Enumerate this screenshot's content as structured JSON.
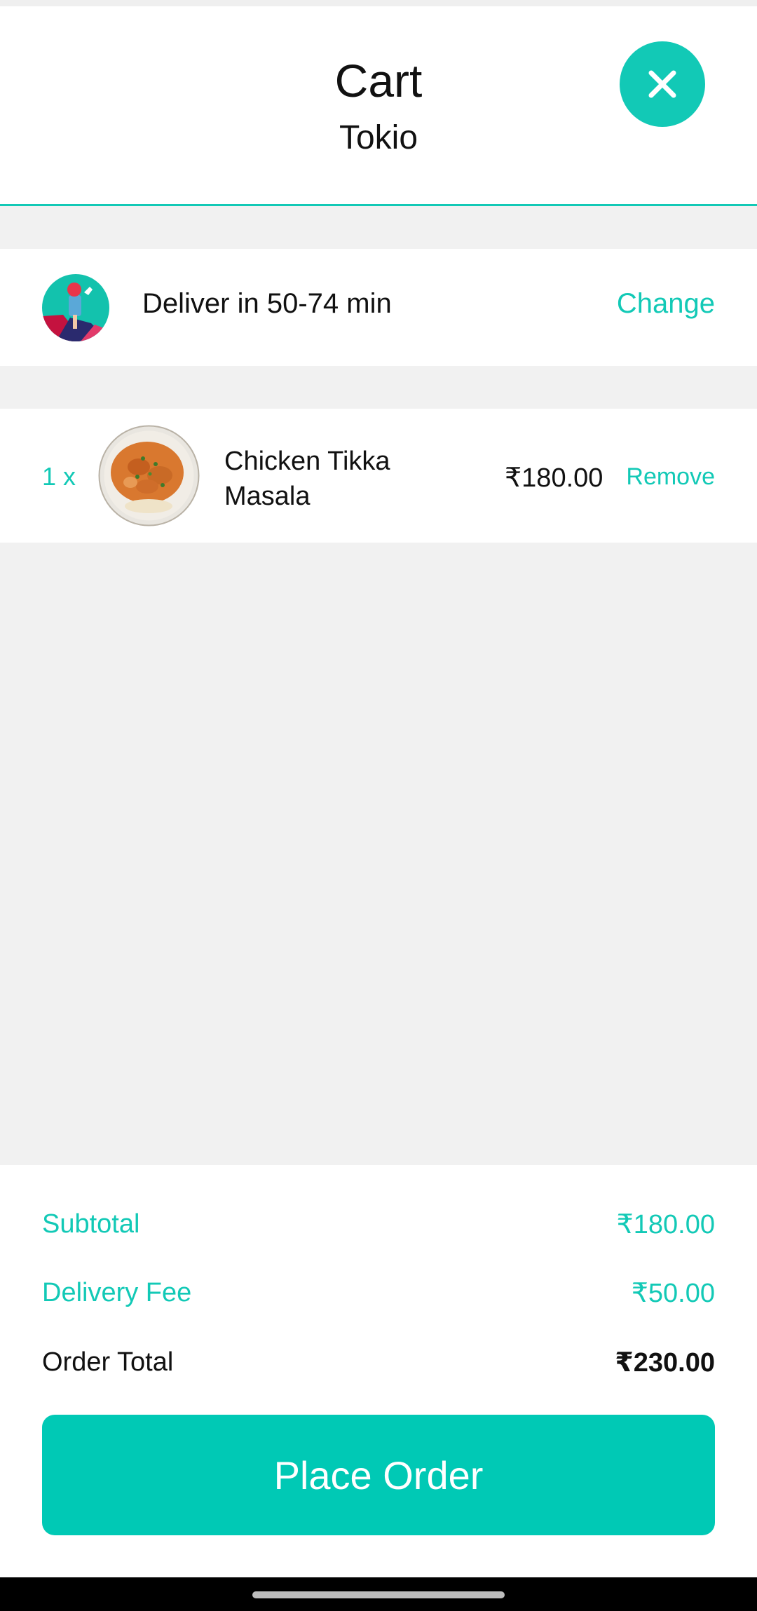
{
  "header": {
    "title": "Cart",
    "subtitle": "Tokio",
    "close_icon": "close-icon"
  },
  "delivery": {
    "text": "Deliver in 50-74 min",
    "change_label": "Change",
    "avatar_icon": "delivery-rider-illustration"
  },
  "items": [
    {
      "quantity": "1 x",
      "name": "Chicken Tikka Masala",
      "price": "₹180.00",
      "remove_label": "Remove"
    }
  ],
  "summary": {
    "subtotal_label": "Subtotal",
    "subtotal_value": "₹180.00",
    "delivery_fee_label": "Delivery Fee",
    "delivery_fee_value": "₹50.00",
    "order_total_label": "Order Total",
    "order_total_value": "₹230.00",
    "place_order_label": "Place Order"
  },
  "colors": {
    "accent": "#12c9b6",
    "button": "#00c9b5",
    "background": "#f1f1f1"
  }
}
